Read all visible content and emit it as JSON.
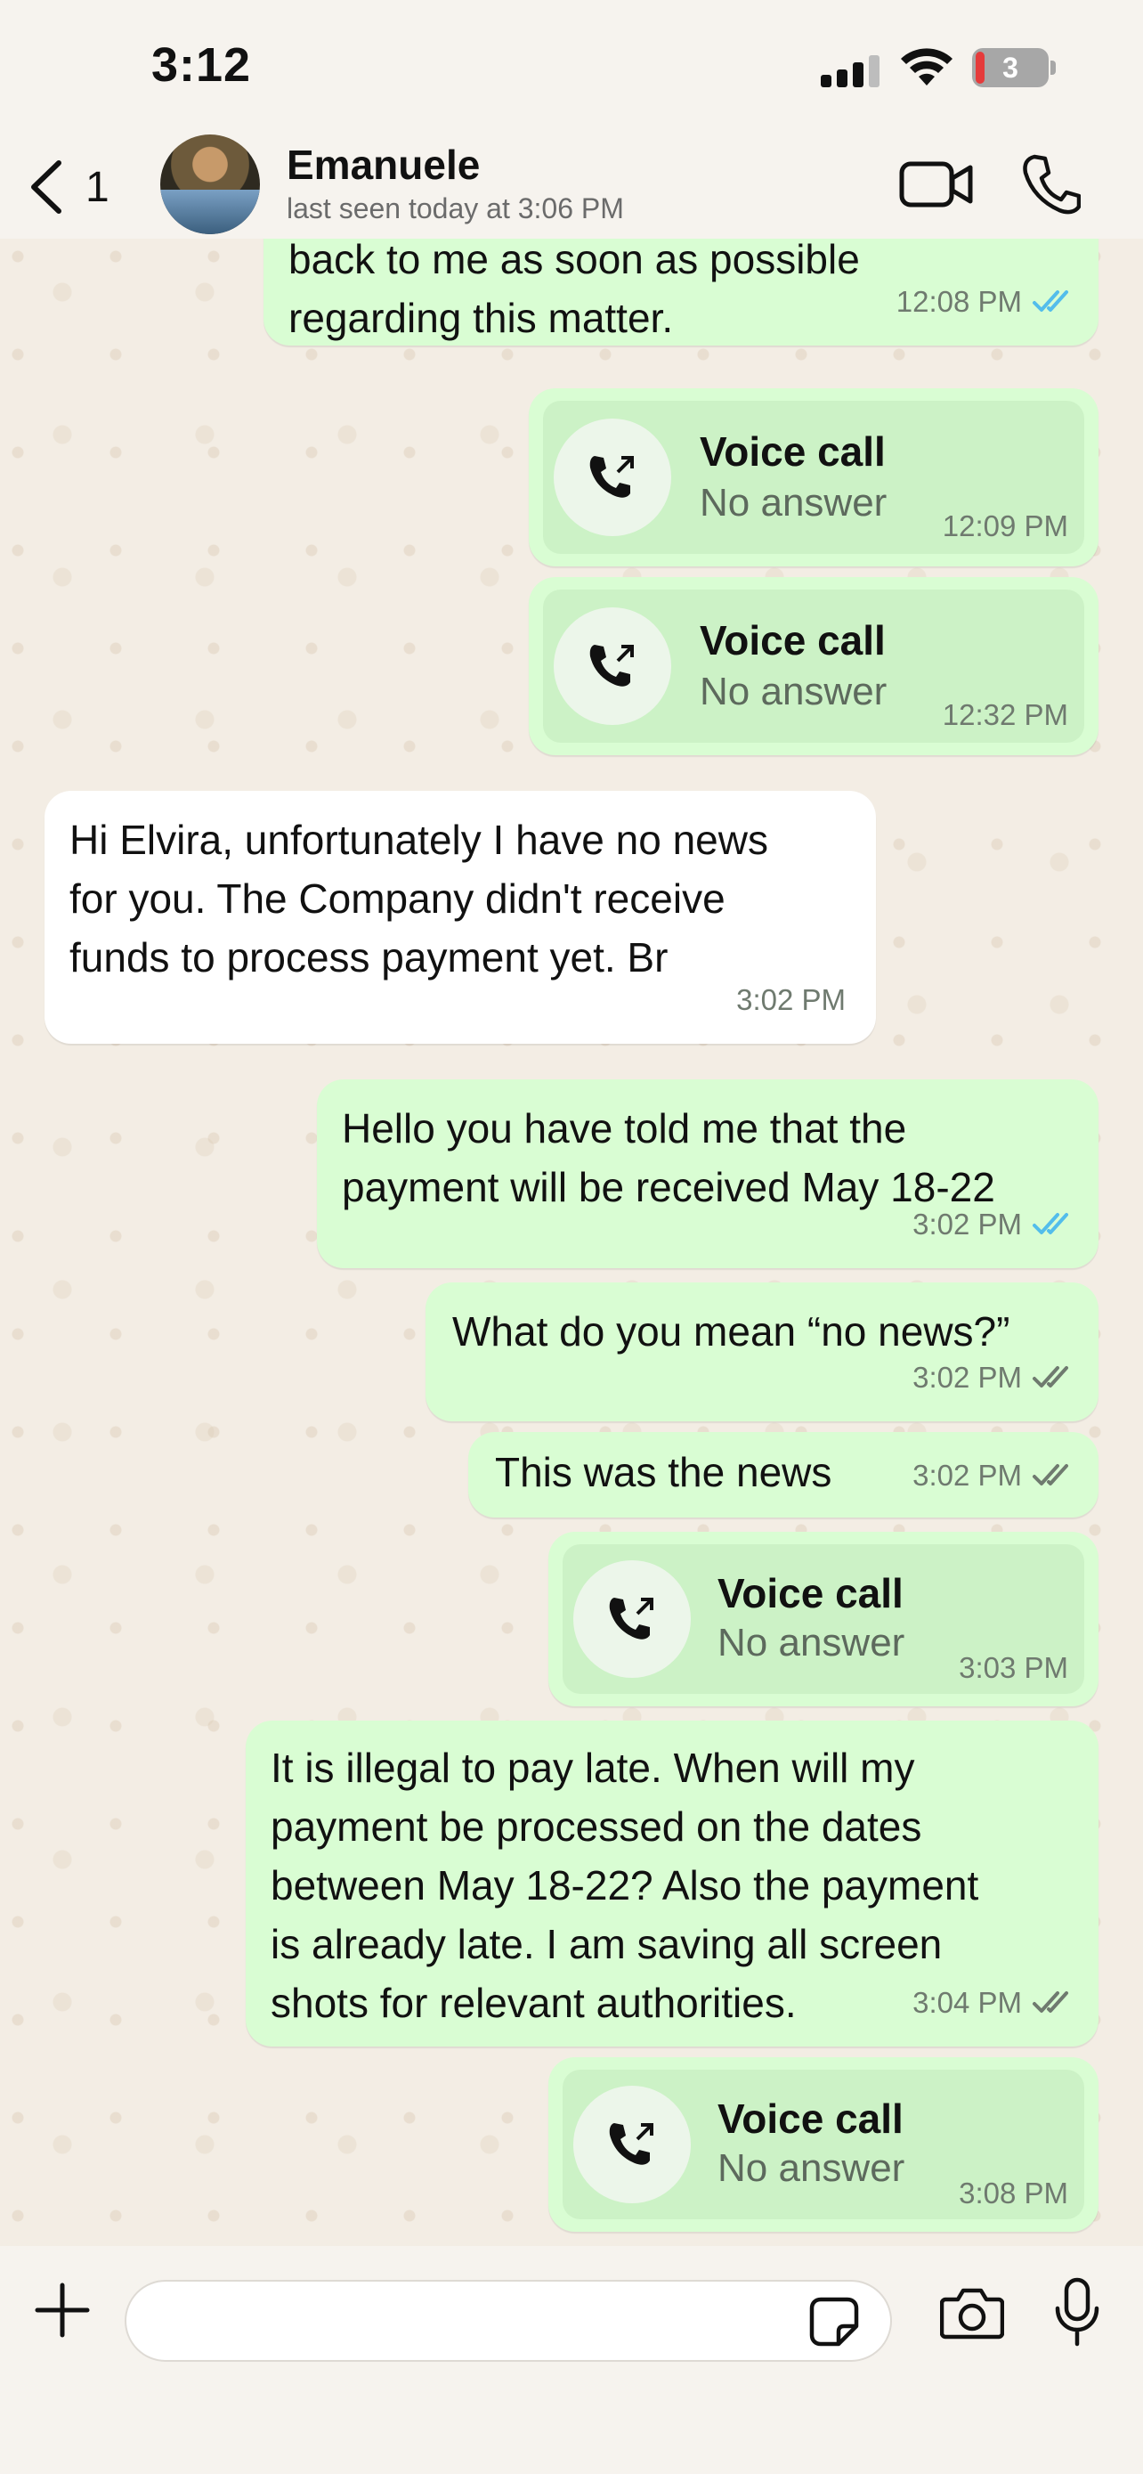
{
  "status_bar": {
    "time": "3:12",
    "battery": "3"
  },
  "header": {
    "back_count": "1",
    "name": "Emanuele",
    "last_seen": "last seen today at 3:06 PM"
  },
  "messages": [
    {
      "type": "out_text",
      "lines": "back to me as soon as possible\nregarding this matter.",
      "time": "12:08 PM",
      "status": "read"
    },
    {
      "type": "call",
      "title": "Voice call",
      "subtitle": "No answer",
      "time": "12:09 PM"
    },
    {
      "type": "call",
      "title": "Voice call",
      "subtitle": "No answer",
      "time": "12:32 PM"
    },
    {
      "type": "in_text",
      "lines": "Hi Elvira, unfortunately I have no news\nfor you. The Company didn't receive\nfunds to process payment yet. Br",
      "time": "3:02 PM"
    },
    {
      "type": "out_text",
      "lines": "Hello you have told me that the\npayment will be received May 18-22",
      "time": "3:02 PM",
      "status": "read"
    },
    {
      "type": "out_text",
      "lines": "What do you mean “no news?”",
      "time": "3:02 PM",
      "status": "delivered"
    },
    {
      "type": "out_text",
      "lines": "This was the news",
      "time": "3:02 PM",
      "status": "delivered"
    },
    {
      "type": "call",
      "title": "Voice call",
      "subtitle": "No answer",
      "time": "3:03 PM"
    },
    {
      "type": "out_text",
      "lines": "It is illegal to pay late. When will my\npayment be processed on the dates\nbetween May 18-22? Also the payment\nis already late. I am saving all screen\nshots for relevant authorities.",
      "time": "3:04 PM",
      "status": "delivered"
    },
    {
      "type": "call",
      "title": "Voice call",
      "subtitle": "No answer",
      "time": "3:08 PM"
    }
  ],
  "composer": {
    "placeholder": ""
  },
  "colors": {
    "outgoing": "#d9fdd3",
    "incoming": "#ffffff",
    "read_tick": "#53bdeb",
    "delivered_tick": "#6f7a6f"
  }
}
